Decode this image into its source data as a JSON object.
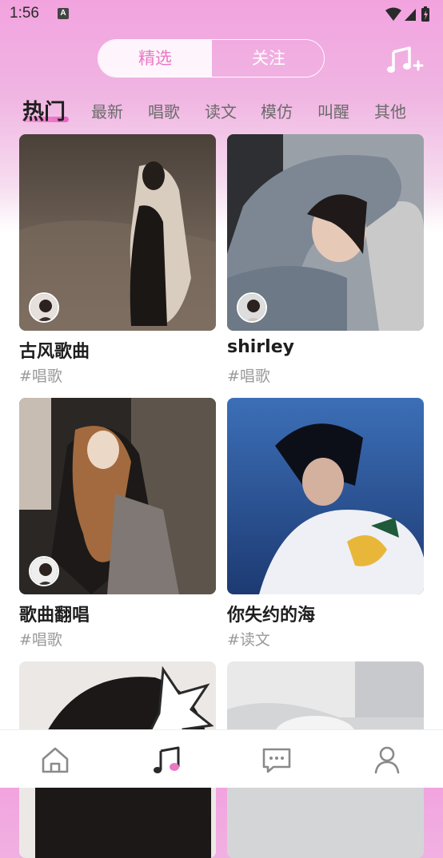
{
  "status_bar": {
    "time": "1:56",
    "notification_icon": "a-notification-icon",
    "icons": [
      "wifi-icon",
      "signal-icon",
      "battery-icon"
    ]
  },
  "header": {
    "segments": [
      {
        "label": "精选",
        "active": true
      },
      {
        "label": "关注",
        "active": false
      }
    ],
    "action_icon": "music-add-icon"
  },
  "categories": [
    {
      "label": "热门",
      "active": true
    },
    {
      "label": "最新",
      "active": false
    },
    {
      "label": "唱歌",
      "active": false
    },
    {
      "label": "读文",
      "active": false
    },
    {
      "label": "模仿",
      "active": false
    },
    {
      "label": "叫醒",
      "active": false
    },
    {
      "label": "其他",
      "active": false
    }
  ],
  "feed": [
    {
      "title": "古风歌曲",
      "tag": "#唱歌",
      "has_avatar": true
    },
    {
      "title": "shirley",
      "tag": "#唱歌",
      "has_avatar": true
    },
    {
      "title": "歌曲翻唱",
      "tag": "#唱歌",
      "has_avatar": true
    },
    {
      "title": "你失约的海",
      "tag": "#读文",
      "has_avatar": false
    },
    {
      "title": "",
      "tag": "",
      "has_avatar": false
    },
    {
      "title": "",
      "tag": "",
      "has_avatar": false
    }
  ],
  "bottom_nav": [
    {
      "icon": "home-icon",
      "active": false
    },
    {
      "icon": "music-note-icon",
      "active": true
    },
    {
      "icon": "chat-icon",
      "active": false
    },
    {
      "icon": "profile-icon",
      "active": false
    }
  ],
  "colors": {
    "accent": "#e978c4",
    "gradient_top": "#f2a3df",
    "text_muted": "#9a9a9a"
  }
}
